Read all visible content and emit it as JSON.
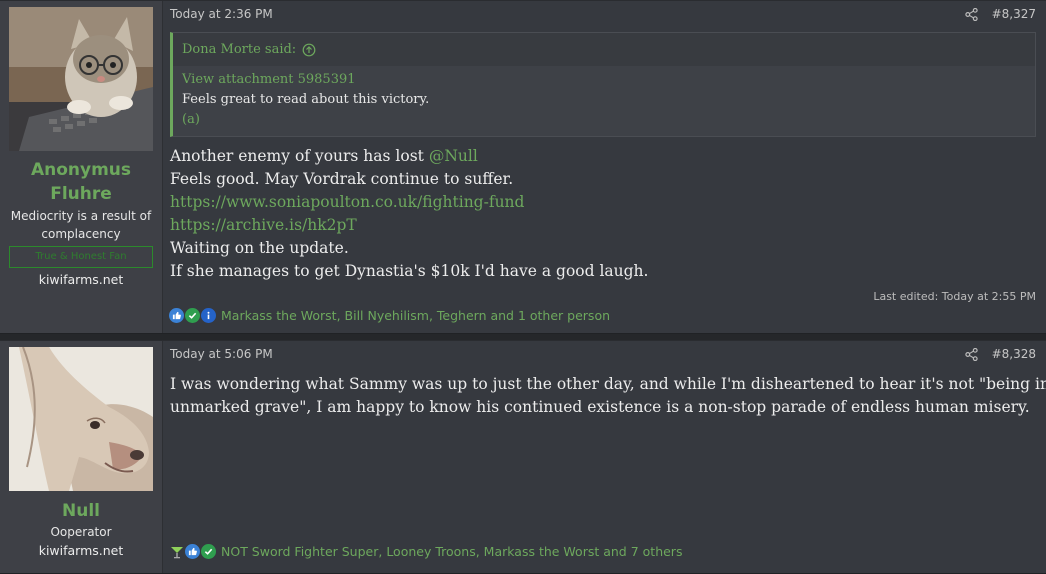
{
  "posts": [
    {
      "author": {
        "name_line1": "Anonymus",
        "name_line2": "Fluhre",
        "title_line1": "Mediocrity is a result of",
        "title_line2": "complacency",
        "banner": "True & Honest Fan",
        "site": "kiwifarms.net"
      },
      "timestamp": "Today at 2:36 PM",
      "post_number": "#8,327",
      "quote": {
        "author_said": "Dona Morte said:",
        "attachment": "View attachment 5985391",
        "text": "Feels great to read about this victory.",
        "footnote": "(a)"
      },
      "body": {
        "line1_text": "Another enemy of yours has lost ",
        "line1_mention": "@Null",
        "line2": "Feels good. May Vordrak continue to suffer.",
        "link1": "https://www.soniapoulton.co.uk/fighting-fund",
        "link2": "https://archive.is/hk2pT",
        "line5": "Waiting on the update.",
        "line6": "If she manages to get Dynastia's $10k I'd have a good laugh."
      },
      "edited": "Last edited: Today at 2:55 PM",
      "reactions": {
        "icons": [
          "like-icon",
          "check-icon",
          "info-icon"
        ],
        "text": "Markass the Worst, Bill Nyehilism, Teghern and 1 other person"
      }
    },
    {
      "author": {
        "name": "Null",
        "title": "Ooperator",
        "site": "kiwifarms.net"
      },
      "timestamp": "Today at 5:06 PM",
      "post_number": "#8,328",
      "body": {
        "line1": "I was wondering what Sammy was up to just the other day, and while I'm disheartened to hear it's not \"being in an",
        "line2": "unmarked grave\", I am happy to know his continued existence is a non-stop parade of endless human misery."
      },
      "reactions": {
        "icons": [
          "cocktail-icon",
          "like-icon",
          "check-icon"
        ],
        "text": "NOT Sword Fighter Super, Looney Troons, Markass the Worst and 7 others"
      }
    }
  ],
  "colors": {
    "accent": "#6da85d",
    "post_bg": "#36393f",
    "sidebar_bg": "#3e4046",
    "page_bg": "#25272a"
  }
}
